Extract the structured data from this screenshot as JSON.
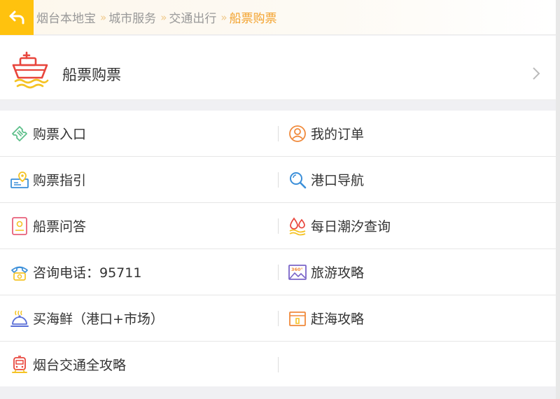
{
  "breadcrumb": {
    "items": [
      "烟台本地宝",
      "城市服务",
      "交通出行"
    ],
    "current": "船票购票",
    "separator": "»"
  },
  "header": {
    "title": "船票购票"
  },
  "menu": {
    "rows": [
      {
        "left": {
          "label": "购票入口",
          "icon": "ticket-icon"
        },
        "right": {
          "label": "我的订单",
          "icon": "user-icon"
        }
      },
      {
        "left": {
          "label": "购票指引",
          "icon": "map-pin-icon"
        },
        "right": {
          "label": "港口导航",
          "icon": "magnifier-icon"
        }
      },
      {
        "left": {
          "label": "船票问答",
          "icon": "document-icon"
        },
        "right": {
          "label": "每日潮汐查询",
          "icon": "water-drop-icon"
        }
      },
      {
        "left": {
          "label": "咨询电话：95711",
          "icon": "phone-icon"
        },
        "right": {
          "label": "旅游攻略",
          "icon": "panorama-360-icon"
        }
      },
      {
        "left": {
          "label": "买海鲜（港口+市场）",
          "icon": "food-cloche-icon"
        },
        "right": {
          "label": "赶海攻略",
          "icon": "guide-box-icon"
        }
      },
      {
        "left": {
          "label": "烟台交通全攻略",
          "icon": "train-icon"
        },
        "right": null
      }
    ]
  },
  "colors": {
    "accent": "#ffc20e",
    "breadcrumb_current": "#f3a12a",
    "ship_red": "#e8453c",
    "wave_yellow": "#f5c324"
  }
}
